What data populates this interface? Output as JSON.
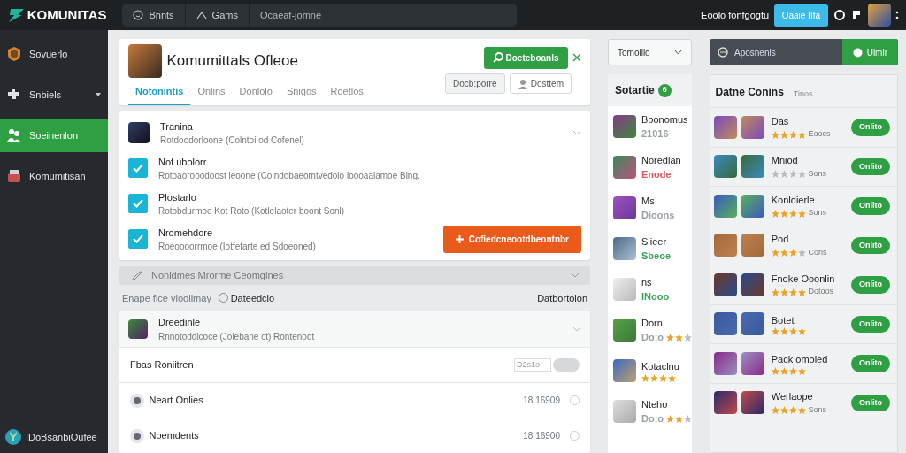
{
  "topbar": {
    "logo": "KOMUNITAS",
    "nav": [
      {
        "label": "Bnnts"
      },
      {
        "label": "Gams"
      }
    ],
    "search": {
      "placeholder": "Ocaeaf-jomne"
    },
    "user_label": "Eoolo fonfgogtu",
    "button": "Oaaie IIfa"
  },
  "sidebar": {
    "items": [
      {
        "label": "Sovuerlo",
        "selected": false,
        "has_menu": false
      },
      {
        "label": "Snbiels",
        "selected": false,
        "has_menu": true
      },
      {
        "label": "Soeinenlon",
        "selected": true,
        "has_menu": false
      },
      {
        "label": "Komumitisan",
        "selected": false,
        "has_menu": false
      }
    ],
    "footer": "IDoBsanbiOufee"
  },
  "header": {
    "title": "Komumittals Ofleoe",
    "tabs": [
      {
        "label": "Notonintis",
        "selected": true
      },
      {
        "label": "Onlins",
        "selected": false
      },
      {
        "label": "Donlolo",
        "selected": false
      },
      {
        "label": "Snigos",
        "selected": false
      },
      {
        "label": "Rdetlos",
        "selected": false
      }
    ],
    "primary_button": "Doeteboanls",
    "secondary_button": "Docb:porre",
    "user_button": "Dosttem"
  },
  "accordion": {
    "items": [
      {
        "kind": "avatar",
        "title": "Tranina",
        "description": "Rotdoodorloone (Colntoi od Cofenel)"
      },
      {
        "kind": "check",
        "checked": true,
        "title": "Nof ubolorr",
        "description": "Rotoaorooodoost leoone (Colndobaeomtvedolo loooaaiamoe Bing."
      },
      {
        "kind": "check",
        "checked": true,
        "title": "Plostarlo",
        "description": "Rotobdurmoe Kot Roto (Kotlelaoter boont Sonl)"
      },
      {
        "kind": "check",
        "checked": true,
        "title": "Nromehdore",
        "description": "Roeoooorrmoe (Iotfefarte ed Sdoeoned)",
        "action": "Cofiedcneootdbeontnbr"
      }
    ],
    "collapsed": "Nonldmes Mrorme Ceomglnes"
  },
  "filter": {
    "label": "Enape fice vioolimay",
    "option": {
      "label": "Dateedclo",
      "selected": false
    },
    "right": "Datbortolon"
  },
  "group": {
    "title": "Dreedinle",
    "description": "Rnnotoddicoce (Jolebane ct) Rontenodt",
    "setting": {
      "label": "Fbas Roniitren",
      "value": "D2s1o",
      "on": false
    },
    "rows": [
      {
        "label": "Neart Onlies",
        "value": "18 16909",
        "selected": false
      },
      {
        "label": "Noemdents",
        "value": "18 16900",
        "selected": false
      }
    ]
  },
  "middle": {
    "dropdown": "Tomolilo",
    "title": "Sotartie",
    "badge": "6",
    "items": [
      {
        "name": "Bbonomus",
        "sub": "21016",
        "color": "#9aa0a6"
      },
      {
        "name": "Noredlan",
        "sub": "Enode",
        "color": "#e0565b"
      },
      {
        "name": "Ms",
        "sub": "Dioons",
        "color": "#9aa0a6"
      },
      {
        "name": "Slieer",
        "sub": "Sbeoe",
        "color": "#3aa35c"
      },
      {
        "name": "ns",
        "sub": "INooo",
        "color": "#3aa35c"
      },
      {
        "name": "Dorn",
        "sub": "Do:o",
        "color": "#9aa0a6",
        "stars": 2
      },
      {
        "name": "Kotaclnu",
        "stars": 4
      },
      {
        "name": "Nteho",
        "sub": "Do:o",
        "color": "#9aa0a6",
        "stars": 2
      }
    ]
  },
  "right": {
    "search": {
      "placeholder": "Aposnenis"
    },
    "button": "Ulmir",
    "title": "Datne Conins",
    "subtitle": "Tinos",
    "rows": [
      {
        "name": "Das",
        "stars": 4,
        "reading": "Eoocs",
        "button": "Onlito"
      },
      {
        "name": "Mniod",
        "stars": 0,
        "reading": "Sons",
        "button": "Onlito"
      },
      {
        "name": "Konldierle",
        "stars": 4,
        "reading": "Sons",
        "button": "Onlito"
      },
      {
        "name": "Pod",
        "stars": 3,
        "reading": "Cons",
        "button": "Onlito"
      },
      {
        "name": "Fnoke Ooonlin",
        "stars": 4,
        "reading": "Dotoos",
        "button": "Onlito"
      },
      {
        "name": "Botet",
        "stars": 4,
        "button": "Onlito"
      },
      {
        "name": "Pack omoled",
        "stars": 4,
        "button": "Onlito"
      },
      {
        "name": "Werlaope",
        "stars": 4,
        "reading": "Sons",
        "button": "Onlito"
      }
    ]
  }
}
